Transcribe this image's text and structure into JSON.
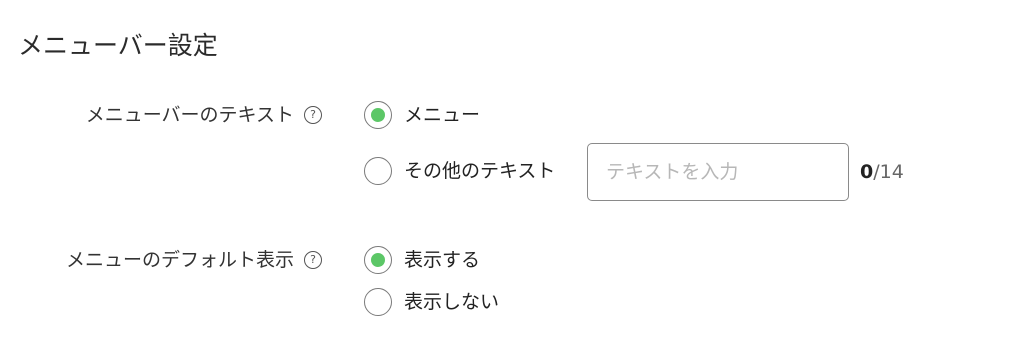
{
  "section": {
    "title": "メニューバー設定"
  },
  "menubar_text": {
    "label": "メニューバーのテキスト",
    "help_icon": "?",
    "options": [
      {
        "label": "メニュー",
        "checked": true
      },
      {
        "label": "その他のテキスト",
        "checked": false
      }
    ],
    "input": {
      "value": "",
      "placeholder": "テキストを入力"
    },
    "counter": {
      "current": "0",
      "max": "/14"
    }
  },
  "menu_default_display": {
    "label": "メニューのデフォルト表示",
    "help_icon": "?",
    "options": [
      {
        "label": "表示する",
        "checked": true
      },
      {
        "label": "表示しない",
        "checked": false
      }
    ]
  },
  "colors": {
    "radio_checked": "#5cc767",
    "radio_border": "#7a7a7a",
    "input_border": "#8a8a8a",
    "placeholder": "#b7b7b7"
  }
}
